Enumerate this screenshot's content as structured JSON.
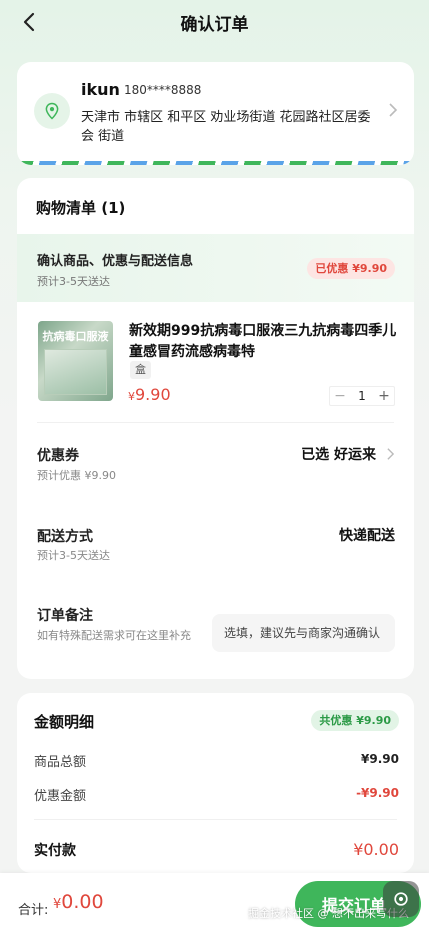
{
  "nav": {
    "title": "确认订单"
  },
  "address": {
    "name": "ikun",
    "phone": "180****8888",
    "line": "天津市 市辖区 和平区 劝业场街道 花园路社区居委会 街道"
  },
  "cart": {
    "title": "购物清单 (1)",
    "band": {
      "title": "确认商品、优惠与配送信息",
      "eta": "预计3-5天送达",
      "badge": "已优惠 ¥9.90"
    },
    "product": {
      "image_label": "抗病毒口服液",
      "name": "新效期999抗病毒口服液三九抗病毒四季儿童感冒药流感病毒特",
      "unit": "盒",
      "currency": "¥",
      "price": "9.90",
      "quantity": "1",
      "minus": "−",
      "plus": "+"
    },
    "coupon": {
      "label": "优惠券",
      "sub": "预计优惠 ¥9.90",
      "value": "已选 好运来"
    },
    "delivery": {
      "label": "配送方式",
      "sub": "预计3-5天送达",
      "value": "快递配送"
    },
    "remark": {
      "label": "订单备注",
      "sub": "如有特殊配送需求可在这里补充",
      "placeholder": "选填，建议先与商家沟通确认"
    }
  },
  "amount": {
    "title": "金额明细",
    "badge": "共优惠 ¥9.90",
    "goods_label": "商品总额",
    "goods_value": "¥9.90",
    "discount_label": "优惠金额",
    "discount_value": "-¥9.90",
    "paid_label": "实付款",
    "paid_value": "¥0.00"
  },
  "bottom": {
    "sum_label": "合计:",
    "currency": "¥",
    "sum_value": "0.00",
    "submit": "提交订单"
  },
  "watermark": "掘金技术社区 @ 想不出来写什么",
  "colors": {
    "accent": "#3fb65b",
    "price": "#e0473c"
  }
}
